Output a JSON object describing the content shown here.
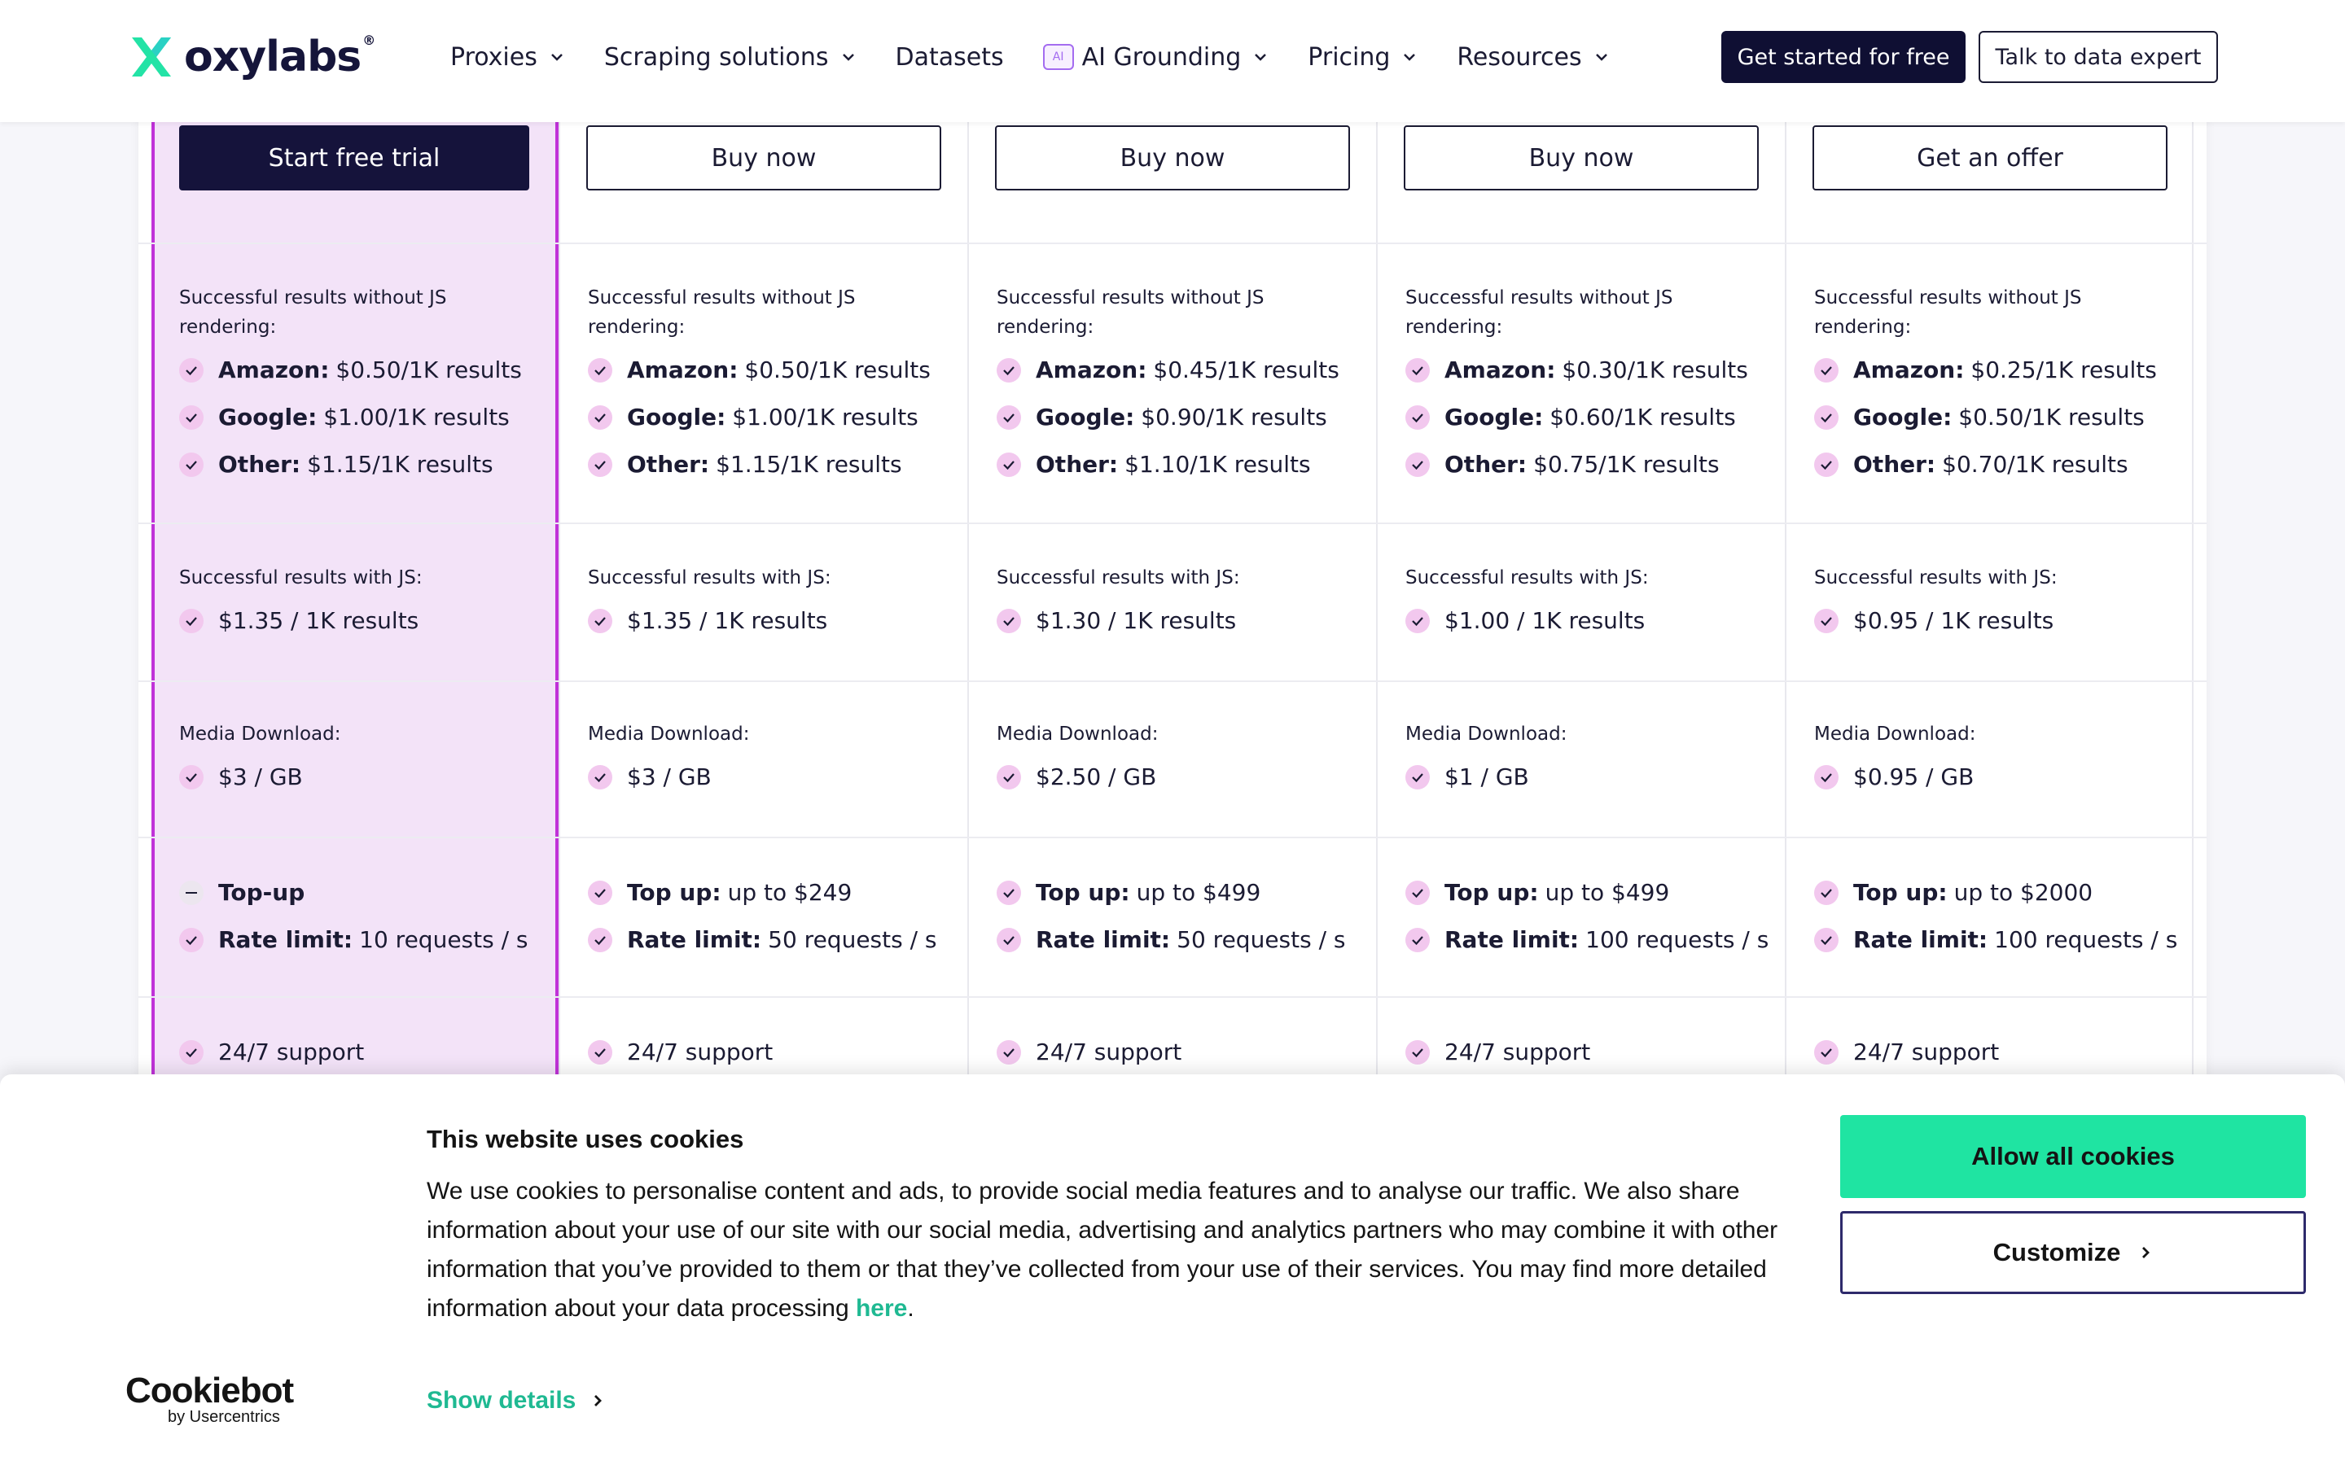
{
  "nav": {
    "logo_text": "oxylabs",
    "logo_reg": "®",
    "items": [
      {
        "label": "Proxies",
        "dropdown": true
      },
      {
        "label": "Scraping solutions",
        "dropdown": true
      },
      {
        "label": "Datasets",
        "dropdown": false
      },
      {
        "label": "AI Grounding",
        "dropdown": true,
        "badge": "AI"
      },
      {
        "label": "Pricing",
        "dropdown": true
      },
      {
        "label": "Resources",
        "dropdown": true
      }
    ],
    "cta_primary": "Get started for free",
    "cta_secondary": "Talk to data expert"
  },
  "plans": [
    {
      "cta": "Start free trial",
      "cta_style": "primary",
      "highlight": true,
      "no_js_title": "Successful results without JS rendering:",
      "no_js": [
        {
          "label": "Amazon:",
          "value": "$0.50/1K results"
        },
        {
          "label": "Google:",
          "value": "$1.00/1K results"
        },
        {
          "label": "Other:",
          "value": "$1.15/1K results"
        }
      ],
      "js_title": "Successful results with JS:",
      "js_value": "$1.35 / 1K results",
      "media_title": "Media Download:",
      "media_value": "$3 / GB",
      "topup": {
        "label": "Top-up",
        "value": "",
        "included": false
      },
      "rate": {
        "label": "Rate limit:",
        "value": "10 requests / s"
      },
      "support": "24/7 support"
    },
    {
      "cta": "Buy now",
      "cta_style": "outline",
      "highlight": false,
      "no_js_title": "Successful results without JS rendering:",
      "no_js": [
        {
          "label": "Amazon:",
          "value": "$0.50/1K results"
        },
        {
          "label": "Google:",
          "value": "$1.00/1K results"
        },
        {
          "label": "Other:",
          "value": "$1.15/1K results"
        }
      ],
      "js_title": "Successful results with JS:",
      "js_value": "$1.35 / 1K results",
      "media_title": "Media Download:",
      "media_value": "$3 / GB",
      "topup": {
        "label": "Top up:",
        "value": "up to $249",
        "included": true
      },
      "rate": {
        "label": "Rate limit:",
        "value": "50 requests / s"
      },
      "support": "24/7 support"
    },
    {
      "cta": "Buy now",
      "cta_style": "outline",
      "highlight": false,
      "no_js_title": "Successful results without JS rendering:",
      "no_js": [
        {
          "label": "Amazon:",
          "value": "$0.45/1K results"
        },
        {
          "label": "Google:",
          "value": "$0.90/1K results"
        },
        {
          "label": "Other:",
          "value": "$1.10/1K results"
        }
      ],
      "js_title": "Successful results with JS:",
      "js_value": "$1.30 / 1K results",
      "media_title": "Media Download:",
      "media_value": "$2.50 / GB",
      "topup": {
        "label": "Top up:",
        "value": "up to $499",
        "included": true
      },
      "rate": {
        "label": "Rate limit:",
        "value": "50 requests / s"
      },
      "support": "24/7 support"
    },
    {
      "cta": "Buy now",
      "cta_style": "outline",
      "highlight": false,
      "no_js_title": "Successful results without JS rendering:",
      "no_js": [
        {
          "label": "Amazon:",
          "value": "$0.30/1K results"
        },
        {
          "label": "Google:",
          "value": "$0.60/1K results"
        },
        {
          "label": "Other:",
          "value": "$0.75/1K results"
        }
      ],
      "js_title": "Successful results with JS:",
      "js_value": "$1.00 / 1K results",
      "media_title": "Media Download:",
      "media_value": "$1 / GB",
      "topup": {
        "label": "Top up:",
        "value": "up to $499",
        "included": true
      },
      "rate": {
        "label": "Rate limit:",
        "value": "100 requests / s"
      },
      "support": "24/7 support"
    },
    {
      "cta": "Get an offer",
      "cta_style": "outline",
      "highlight": false,
      "no_js_title": "Successful results without JS rendering:",
      "no_js": [
        {
          "label": "Amazon:",
          "value": "$0.25/1K results"
        },
        {
          "label": "Google:",
          "value": "$0.50/1K results"
        },
        {
          "label": "Other:",
          "value": "$0.70/1K results"
        }
      ],
      "js_title": "Successful results with JS:",
      "js_value": "$0.95 / 1K results",
      "media_title": "Media Download:",
      "media_value": "$0.95 / GB",
      "topup": {
        "label": "Top up:",
        "value": "up to $2000",
        "included": true
      },
      "rate": {
        "label": "Rate limit:",
        "value": "100 requests / s"
      },
      "support": "24/7 support"
    }
  ],
  "cookie": {
    "title": "This website uses cookies",
    "text": "We use cookies to personalise content and ads, to provide social media features and to analyse our traffic. We also share information about your use of our site with our social media, advertising and analytics partners who may combine it with other information that you’ve provided to them or that they’ve collected from your use of their services. You may find more detailed information about your data processing ",
    "link_text": "here",
    "text_end": ".",
    "brand": "Cookiebot",
    "brand_sub": "by Usercentrics",
    "show_details": "Show details",
    "allow_all": "Allow all cookies",
    "customize": "Customize"
  },
  "colors": {
    "accent_green": "#1fe4a2",
    "highlight_border": "#c032d8",
    "highlight_bg": "#f3e3f8",
    "dark_navy": "#15133b"
  }
}
